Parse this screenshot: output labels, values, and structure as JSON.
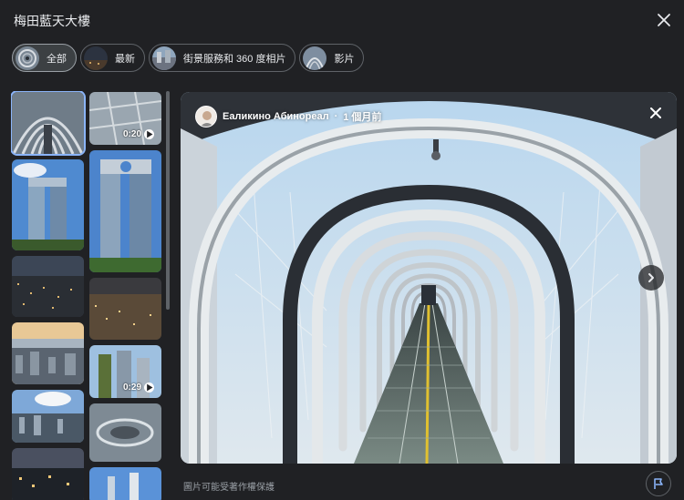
{
  "header": {
    "title": "梅田藍天大樓"
  },
  "filters": [
    {
      "label": "全部",
      "active": true
    },
    {
      "label": "最新",
      "active": false
    },
    {
      "label": "街景服務和 360 度相片",
      "active": false
    },
    {
      "label": "影片",
      "active": false
    }
  ],
  "thumbnails": {
    "video1_duration": "0:20",
    "video2_duration": "0:29"
  },
  "viewer": {
    "author": "Еаликино Абинореал",
    "separator": "·",
    "time": "1 個月前"
  },
  "footer": {
    "copyright_notice": "圖片可能受著作權保護"
  },
  "icons": {
    "close": "close-icon",
    "next": "chevron-right-icon",
    "play": "play-icon",
    "report": "flag-icon"
  },
  "colors": {
    "background": "#202124",
    "accent": "#8ab4f8",
    "chip_border": "#5f6368"
  }
}
